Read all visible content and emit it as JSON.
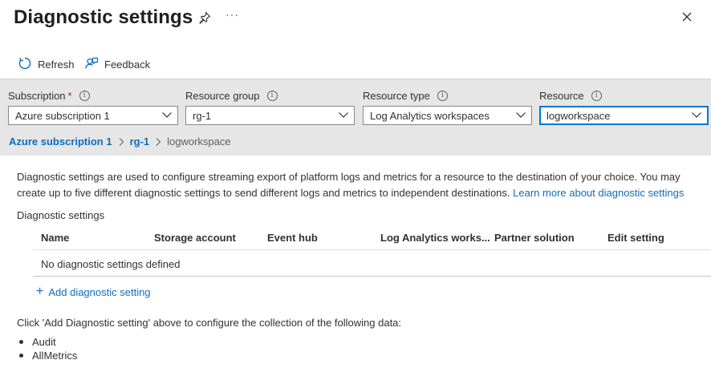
{
  "header": {
    "title": "Diagnostic settings",
    "more_glyph": "···"
  },
  "toolbar": {
    "refresh_label": "Refresh",
    "feedback_label": "Feedback"
  },
  "filters": {
    "subscription": {
      "label": "Subscription",
      "required_mark": "*",
      "value": "Azure subscription 1"
    },
    "resource_group": {
      "label": "Resource group",
      "value": "rg-1"
    },
    "resource_type": {
      "label": "Resource type",
      "value": "Log Analytics workspaces"
    },
    "resource": {
      "label": "Resource",
      "value": "logworkspace"
    },
    "info_glyph": "i"
  },
  "breadcrumb": {
    "items": [
      "Azure subscription 1",
      "rg-1",
      "logworkspace"
    ]
  },
  "description": {
    "text": "Diagnostic settings are used to configure streaming export of platform logs and metrics for a resource to the destination of your choice. You may create up to five different diagnostic settings to send different logs and metrics to independent destinations.",
    "link": "Learn more about diagnostic settings"
  },
  "settings_table": {
    "section_label": "Diagnostic settings",
    "columns": [
      "Name",
      "Storage account",
      "Event hub",
      "Log Analytics works...",
      "Partner solution",
      "Edit setting"
    ],
    "empty_message": "No diagnostic settings defined"
  },
  "add_setting": {
    "plus": "+",
    "label": "Add diagnostic setting"
  },
  "data_note": {
    "text": "Click 'Add Diagnostic setting' above to configure the collection of the following data:",
    "items": [
      "Audit",
      "AllMetrics"
    ]
  },
  "colors": {
    "link": "#0f6cbd",
    "focus_border": "#0078d4",
    "filter_bg": "#e6e6e6",
    "required": "#a4262c"
  },
  "icons": {
    "pin": "pin-icon",
    "more": "more-icon",
    "close": "close-icon",
    "refresh": "refresh-icon",
    "feedback": "feedback-icon",
    "info": "info-icon",
    "chevron": "chevron-down-icon",
    "breadcrumb_separator": "chevron-right-icon"
  }
}
